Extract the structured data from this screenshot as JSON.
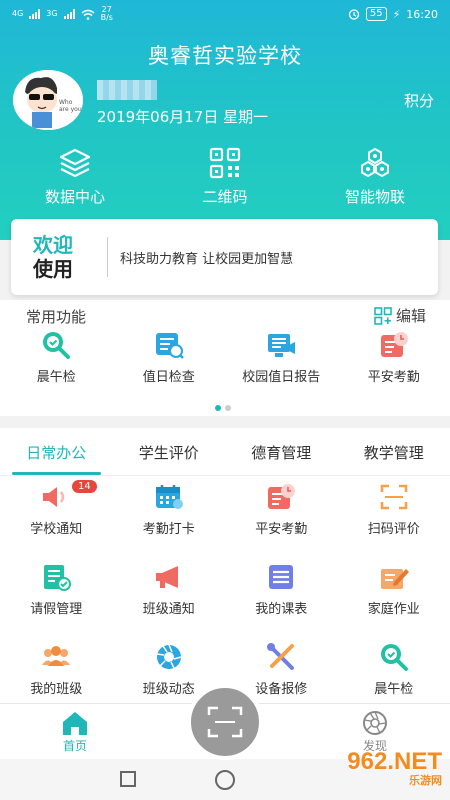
{
  "statusbar": {
    "sig1": "4G",
    "sig2": "3G",
    "speed_value": "27",
    "speed_unit": "B/s",
    "battery": "55",
    "time": "16:20"
  },
  "header": {
    "school_name": "奥睿哲实验学校",
    "date": "2019年06月17日 星期一",
    "points_label": "积分"
  },
  "quick_links": [
    {
      "label": "数据中心",
      "icon": "layers-icon"
    },
    {
      "label": "二维码",
      "icon": "qrcode-icon"
    },
    {
      "label": "智能物联",
      "icon": "hexagon-cluster-icon"
    }
  ],
  "welcome": {
    "title_line1": "欢迎",
    "title_line2": "使用",
    "slogan": "科技助力教育  让校园更加智慧"
  },
  "common_functions": {
    "title": "常用功能",
    "edit_label": "编辑",
    "items": [
      {
        "label": "晨午检",
        "icon": "magnifier-check-icon"
      },
      {
        "label": "值日检查",
        "icon": "duty-check-icon"
      },
      {
        "label": "校园值日报告",
        "icon": "report-icon"
      },
      {
        "label": "平安考勤",
        "icon": "attendance-clock-icon"
      }
    ]
  },
  "tabs": [
    {
      "label": "日常办公",
      "active": true
    },
    {
      "label": "学生评价",
      "active": false
    },
    {
      "label": "德育管理",
      "active": false
    },
    {
      "label": "教学管理",
      "active": false
    }
  ],
  "functions": [
    {
      "label": "学校通知",
      "icon": "speaker-icon",
      "badge": "14"
    },
    {
      "label": "考勤打卡",
      "icon": "calendar-icon"
    },
    {
      "label": "平安考勤",
      "icon": "attendance-clock-icon"
    },
    {
      "label": "扫码评价",
      "icon": "scan-icon"
    },
    {
      "label": "请假管理",
      "icon": "leave-form-icon"
    },
    {
      "label": "班级通知",
      "icon": "megaphone-icon"
    },
    {
      "label": "我的课表",
      "icon": "timetable-icon"
    },
    {
      "label": "家庭作业",
      "icon": "homework-icon"
    },
    {
      "label": "我的班级",
      "icon": "group-icon"
    },
    {
      "label": "班级动态",
      "icon": "aperture-icon"
    },
    {
      "label": "设备报修",
      "icon": "tools-icon"
    },
    {
      "label": "晨午检",
      "icon": "magnifier-check-icon"
    }
  ],
  "bottom_nav": {
    "home_label": "首页",
    "discover_label": "发现"
  },
  "watermark": {
    "brand": "962.NET",
    "sub": "乐游网"
  },
  "colors": {
    "accent": "#20b7b9",
    "header_gradient_top": "#1fb7d7",
    "header_gradient_bottom": "#22cfc0",
    "badge": "#e8453c"
  }
}
